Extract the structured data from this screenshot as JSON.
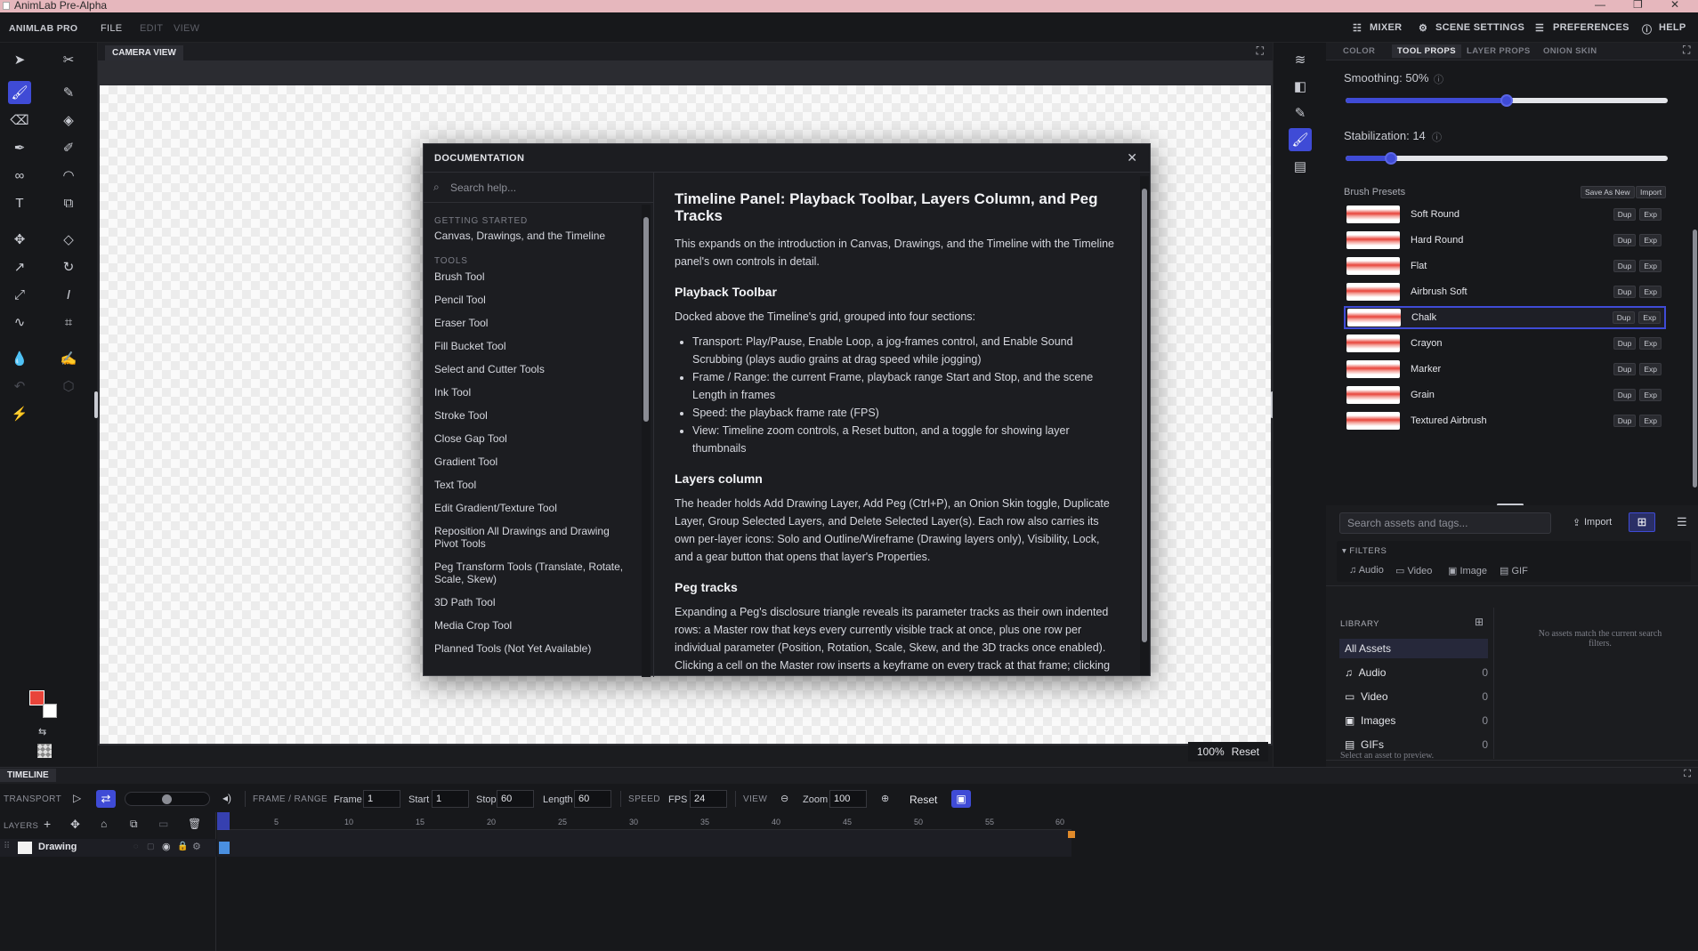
{
  "titlebar": {
    "title": "AnimLab Pre-Alpha",
    "min": "—",
    "max": "❐",
    "close": "✕"
  },
  "menubar": {
    "brand": "ANIMLAB PRO",
    "file": "FILE",
    "edit": "EDIT",
    "view": "VIEW",
    "mixer": "MIXER",
    "scene_settings": "SCENE SETTINGS",
    "preferences": "PREFERENCES",
    "help": "HELP"
  },
  "camera": {
    "tab": "CAMERA VIEW",
    "zoom": "100%",
    "reset": "Reset"
  },
  "doc": {
    "title": "DOCUMENTATION",
    "search_placeholder": "Search help...",
    "sections": {
      "getting_started": "GETTING STARTED",
      "tools": "TOOLS"
    },
    "getting_started_items": [
      "Canvas, Drawings, and the Timeline"
    ],
    "tool_items": [
      "Brush Tool",
      "Pencil Tool",
      "Eraser Tool",
      "Fill Bucket Tool",
      "Select and Cutter Tools",
      "Ink Tool",
      "Stroke Tool",
      "Close Gap Tool",
      "Gradient Tool",
      "Text Tool",
      "Edit Gradient/Texture Tool",
      "Reposition All Drawings and Drawing Pivot Tools",
      "Peg Transform Tools (Translate, Rotate, Scale, Skew)",
      "3D Path Tool",
      "Media Crop Tool",
      "Planned Tools (Not Yet Available)"
    ],
    "content": {
      "h1": "Timeline Panel: Playback Toolbar, Layers Column, and Peg Tracks",
      "intro": "This expands on the introduction in Canvas, Drawings, and the Timeline with the Timeline panel's own controls in detail.",
      "h_playback": "Playback Toolbar",
      "p_playback": "Docked above the Timeline's grid, grouped into four sections:",
      "bullets": [
        "Transport: Play/Pause, Enable Loop, a jog-frames control, and Enable Sound Scrubbing (plays audio grains at drag speed while jogging)",
        "Frame / Range: the current Frame, playback range Start and Stop, and the scene Length in frames",
        "Speed: the playback frame rate (FPS)",
        "View: Timeline zoom controls, a Reset button, and a toggle for showing layer thumbnails"
      ],
      "h_layers": "Layers column",
      "p_layers": "The header holds Add Drawing Layer, Add Peg (Ctrl+P), an Onion Skin toggle, Duplicate Layer, Group Selected Layers, and Delete Selected Layer(s). Each row also carries its own per-layer icons: Solo and Outline/Wireframe (Drawing layers only), Visibility, Lock, and a gear button that opens that layer's Properties.",
      "h_peg": "Peg tracks",
      "p_peg": "Expanding a Peg's disclosure triangle reveals its parameter tracks as their own indented rows: a Master row that keys every currently visible track at once, plus one row per individual parameter (Position, Rotation, Scale, Skew, and the 3D tracks once enabled). Clicking a cell on the Master row inserts a keyframe on every track at that frame; clicking a cell on a single track row inserts a keyframe on just that track, or toggles its interpolation if one is already there. Double-click a single track row, or use its gear button, to open the Function Editor"
    }
  },
  "right_tabs": [
    "COLOR",
    "TOOL PROPS",
    "LAYER PROPS",
    "ONION SKIN"
  ],
  "props": {
    "smoothing_label": "Smoothing: 50%",
    "smoothing_value": 0.5,
    "stabilization_label": "Stabilization: 14",
    "stabilization_value": 0.14,
    "presets_label": "Brush Presets",
    "save_as_new": "Save As New",
    "import": "Import",
    "dup": "Dup",
    "exp": "Exp",
    "presets": [
      "Soft Round",
      "Hard Round",
      "Flat",
      "Airbrush Soft",
      "Chalk",
      "Crayon",
      "Marker",
      "Grain",
      "Textured Airbrush"
    ],
    "selected_preset": "Chalk"
  },
  "assets": {
    "search_placeholder": "Search assets and tags...",
    "import": "Import",
    "filters": "FILTERS",
    "filter_items": [
      "Audio",
      "Video",
      "Image",
      "GIF"
    ],
    "library": "LIBRARY",
    "lib_items": [
      {
        "label": "All Assets",
        "count": ""
      },
      {
        "label": "Audio",
        "count": "0"
      },
      {
        "label": "Video",
        "count": "0"
      },
      {
        "label": "Images",
        "count": "0"
      },
      {
        "label": "GIFs",
        "count": "0"
      }
    ],
    "empty": "No assets match the current search filters.",
    "preview": "Select an asset to preview."
  },
  "timeline": {
    "tab": "TIMELINE",
    "transport": "TRANSPORT",
    "frame_range": "FRAME / RANGE",
    "frame_label": "Frame",
    "frame": "1",
    "start_label": "Start",
    "start": "1",
    "stop_label": "Stop",
    "stop": "60",
    "length_label": "Length",
    "length": "60",
    "speed": "SPEED",
    "fps_label": "FPS",
    "fps": "24",
    "view": "VIEW",
    "zoom_label": "Zoom",
    "zoom": "100",
    "reset": "Reset",
    "layers": "LAYERS",
    "layer_name": "Drawing",
    "ticks": [
      "5",
      "10",
      "15",
      "20",
      "25",
      "30",
      "35",
      "40",
      "45",
      "50",
      "55",
      "60"
    ]
  },
  "colors": {
    "accent": "#3f4bd6",
    "primary_color": "#e8443a",
    "secondary_color": "#ffffff"
  }
}
